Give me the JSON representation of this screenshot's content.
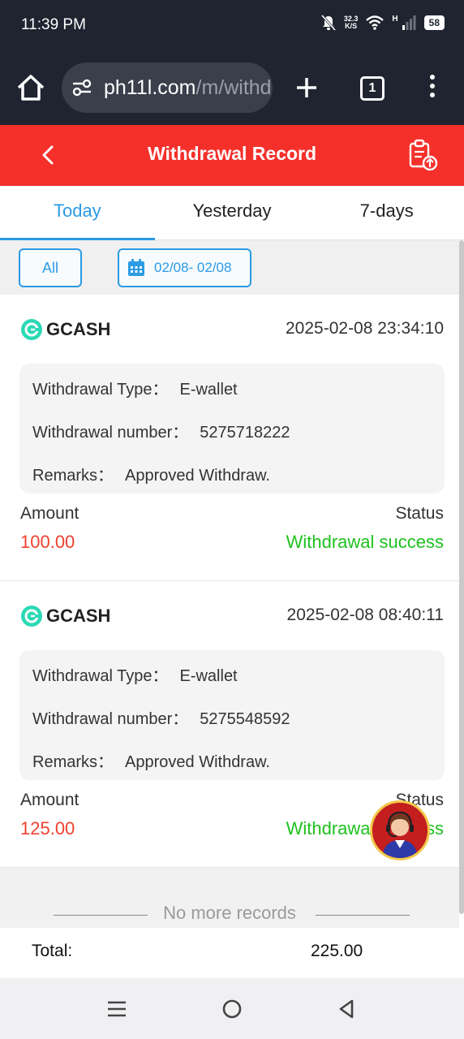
{
  "status_bar": {
    "time": "11:39 PM",
    "net_speed_value": "32.3",
    "net_speed_unit": "K/S",
    "signal_label": "H",
    "battery": "58"
  },
  "browser": {
    "url_main": "ph11l.com",
    "url_path": "/m/withd",
    "tab_count": "1"
  },
  "header": {
    "title": "Withdrawal Record"
  },
  "tabs": [
    {
      "label": "Today",
      "active": true
    },
    {
      "label": "Yesterday",
      "active": false
    },
    {
      "label": "7-days",
      "active": false
    }
  ],
  "filters": {
    "type_label": "All",
    "date_range": "02/08- 02/08"
  },
  "records": [
    {
      "provider": "GCASH",
      "datetime": "2025-02-08 23:34:10",
      "type_label": "Withdrawal Type：",
      "type_value": "E-wallet",
      "number_label": "Withdrawal number：",
      "number_value": "5275718222",
      "remarks_label": "Remarks：",
      "remarks_value": "Approved Withdraw.",
      "amount_label": "Amount",
      "status_label": "Status",
      "amount": "100.00",
      "status": "Withdrawal success"
    },
    {
      "provider": "GCASH",
      "datetime": "2025-02-08 08:40:11",
      "type_label": "Withdrawal Type：",
      "type_value": "E-wallet",
      "number_label": "Withdrawal number：",
      "number_value": "5275548592",
      "remarks_label": "Remarks：",
      "remarks_value": "Approved Withdraw.",
      "amount_label": "Amount",
      "status_label": "Status",
      "amount": "125.00",
      "status": "Withdrawal success"
    }
  ],
  "list_end": "No more records",
  "total": {
    "label": "Total:",
    "value": "225.00"
  },
  "colors": {
    "header_red": "#f5302b",
    "accent_blue": "#2b9be6",
    "amount_red": "#f0402e",
    "success_green": "#1ec11e"
  },
  "icons": [
    "home-icon",
    "site-settings-icon",
    "plus-icon",
    "tabs-icon",
    "more-vert-icon",
    "back-arrow-icon",
    "export-record-icon",
    "calendar-icon",
    "gcash-logo-icon",
    "support-agent-icon",
    "recents-icon",
    "home-circle-icon",
    "back-triangle-icon"
  ]
}
